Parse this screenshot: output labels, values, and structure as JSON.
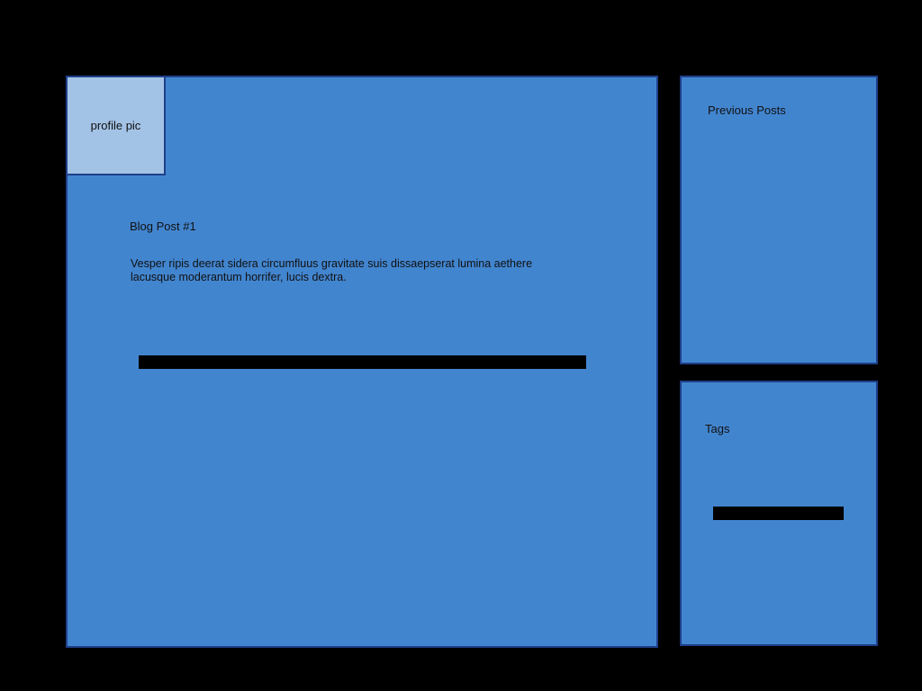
{
  "main": {
    "profile_pic_label": "profile pic",
    "post_title": "Blog Post #1",
    "post_body": "Vesper ripis deerat sidera circumfluus gravitate suis dissaepserat lumina aethere lacusque moderantum horrifer, lucis dextra."
  },
  "sidebar": {
    "previous_posts_title": "Previous Posts",
    "tags_title": "Tags"
  },
  "colors": {
    "background": "#000000",
    "panel": "#4285cf",
    "panel_border": "#1f3f8a",
    "profile_pic": "#a3c3e6",
    "bar": "#000000"
  }
}
